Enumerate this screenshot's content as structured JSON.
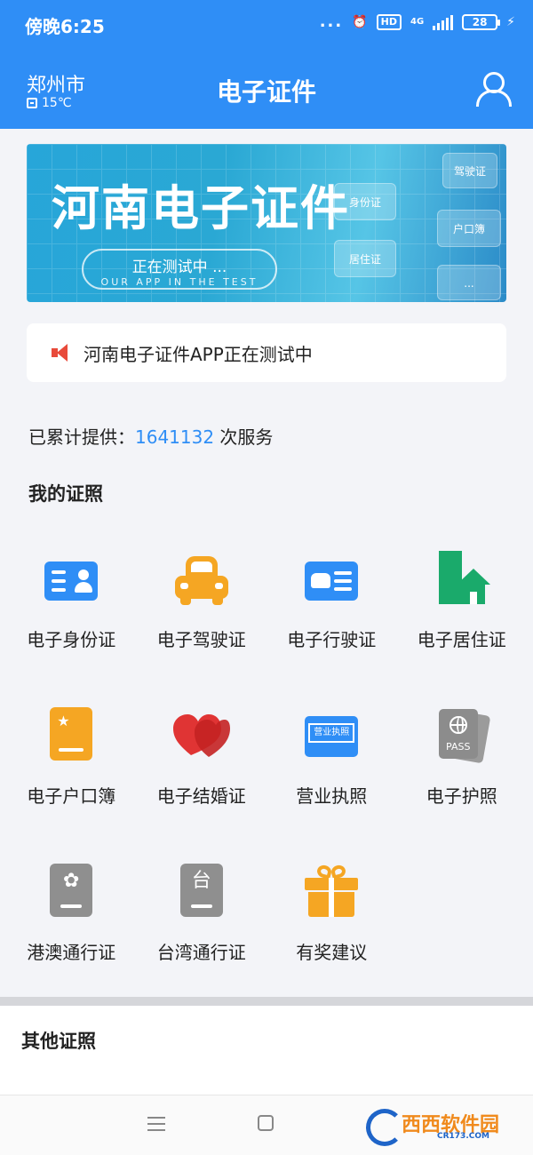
{
  "status_bar": {
    "time": "傍晚6:25",
    "dots": "...",
    "hd": "HD",
    "network": "4G",
    "battery": "28"
  },
  "header": {
    "city": "郑州市",
    "weather": "15℃",
    "title": "电子证件"
  },
  "banner": {
    "title": "河南电子证件",
    "subtitle": "正在测试中 ...",
    "subtitle_en": "OUR APP IN THE TEST",
    "cards": [
      "驾驶证",
      "身份证",
      "户口簿",
      "居住证",
      "..."
    ]
  },
  "notice": {
    "text": "河南电子证件APP正在测试中"
  },
  "service_counter": {
    "prefix": "已累计提供：",
    "count": "1641132",
    "suffix": " 次服务"
  },
  "my_certificates": {
    "title": "我的证照",
    "items": [
      {
        "label": "电子身份证",
        "icon": "id-card-icon"
      },
      {
        "label": "电子驾驶证",
        "icon": "car-icon"
      },
      {
        "label": "电子行驶证",
        "icon": "vehicle-license-icon"
      },
      {
        "label": "电子居住证",
        "icon": "house-icon"
      },
      {
        "label": "电子户口簿",
        "icon": "household-book-icon"
      },
      {
        "label": "电子结婚证",
        "icon": "hearts-icon"
      },
      {
        "label": "营业执照",
        "icon": "business-license-icon"
      },
      {
        "label": "电子护照",
        "icon": "passport-icon"
      },
      {
        "label": "港澳通行证",
        "icon": "hk-macau-pass-icon"
      },
      {
        "label": "台湾通行证",
        "icon": "taiwan-pass-icon"
      },
      {
        "label": "有奖建议",
        "icon": "gift-icon"
      }
    ],
    "business_license_icon_text": "营业执照",
    "passport_icon_text": "PASS",
    "taiwan_icon_text": "台"
  },
  "other_certificates": {
    "title": "其他证照"
  },
  "watermark": {
    "main": "西西软件园",
    "sub": "CR173.COM"
  },
  "colors": {
    "primary": "#2f8ef6",
    "orange": "#f5a623",
    "green": "#1aaa6b",
    "red": "#e03434",
    "gray": "#8f8f8f"
  }
}
